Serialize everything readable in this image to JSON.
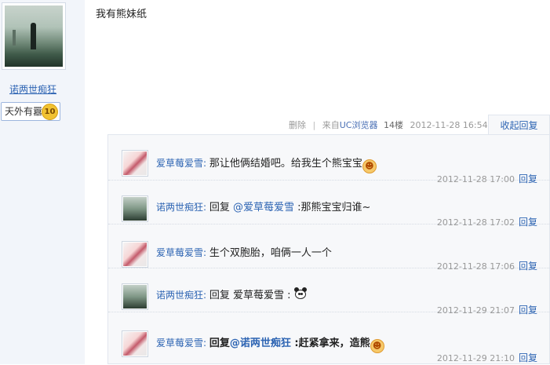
{
  "author": {
    "name": "诺两世痴狂",
    "rank_title": "天外有囂",
    "level": "10"
  },
  "post": {
    "text": "我有熊妹纸",
    "delete_label": "删除",
    "source_prefix": "来自",
    "source_name": "UC浏览器",
    "floor": "14楼",
    "time": "2012-11-28 16:54",
    "collapse_label": "收起回复"
  },
  "replies": [
    {
      "user": "爱草莓爱雪:",
      "prefix": "",
      "at": "",
      "message": "那让他俩结婚吧。给我生个熊宝宝",
      "emoji": "smile",
      "time": "2012-11-28 17:00",
      "reply_label": "回复"
    },
    {
      "user": "诺两世痴狂:",
      "prefix": "回复 ",
      "at": "@爱草莓爱雪",
      "message": " :那熊宝宝归谁~",
      "emoji": "",
      "time": "2012-11-28 17:02",
      "reply_label": "回复"
    },
    {
      "user": "爱草莓爱雪:",
      "prefix": "",
      "at": "",
      "message": "生个双胞胎，咱俩一人一个",
      "emoji": "",
      "time": "2012-11-28 17:06",
      "reply_label": "回复"
    },
    {
      "user": "诺两世痴狂:",
      "prefix": "回复 爱草莓爱雪 :",
      "at": "",
      "message": "",
      "emoji": "panda",
      "time": "2012-11-29 21:07",
      "reply_label": "回复"
    },
    {
      "user": "爱草莓爱雪:",
      "prefix": "回复",
      "at": "@诺两世痴狂",
      "message": " :赶紧拿来，造熊",
      "emoji": "smile",
      "time": "2012-11-29 21:10",
      "reply_label": "回复"
    }
  ]
}
